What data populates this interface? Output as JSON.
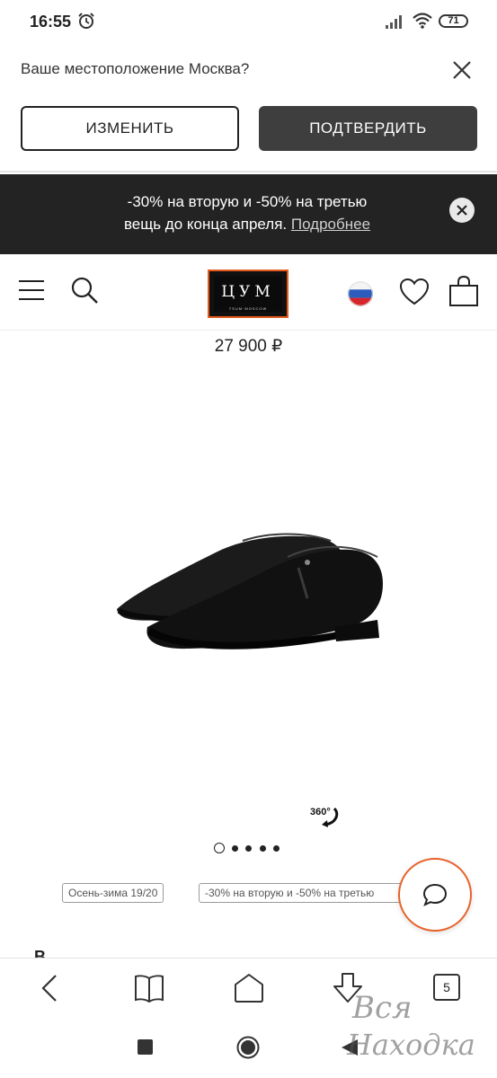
{
  "status_bar": {
    "time": "16:55",
    "battery": "71",
    "icons": [
      "alarm-icon",
      "signal-icon",
      "wifi-icon",
      "battery-icon"
    ]
  },
  "location_prompt": {
    "question": "Ваше местоположение Москва?",
    "change_label": "ИЗМЕНИТЬ",
    "confirm_label": "ПОДТВЕРДИТЬ"
  },
  "promo": {
    "line1": "-30% на вторую и -50% на третью",
    "line2": "вещь до конца апреля.",
    "link": "Подробнее"
  },
  "header": {
    "logo_text": "ЦУМ",
    "logo_sub": "TSUM·MOSCOW",
    "brand_color": "#e35a1c"
  },
  "product": {
    "price": "27 900 ₽",
    "badge_360": "360°",
    "gallery": {
      "total": 5,
      "active": 1
    },
    "tags": [
      "Осень-зима 19/20",
      "-30% на вторую и -50% на третью"
    ],
    "next_section_initial": "В"
  },
  "browser_toolbar": {
    "tab_count": "5",
    "icons": [
      "back-icon",
      "bookmarks-icon",
      "home-icon",
      "download-icon",
      "tabs-icon"
    ]
  },
  "watermark": {
    "line1": "Вся",
    "line2": "Находка"
  },
  "colors": {
    "accent": "#e8622a",
    "dark_button": "#3e3e3e",
    "banner": "#232323"
  }
}
